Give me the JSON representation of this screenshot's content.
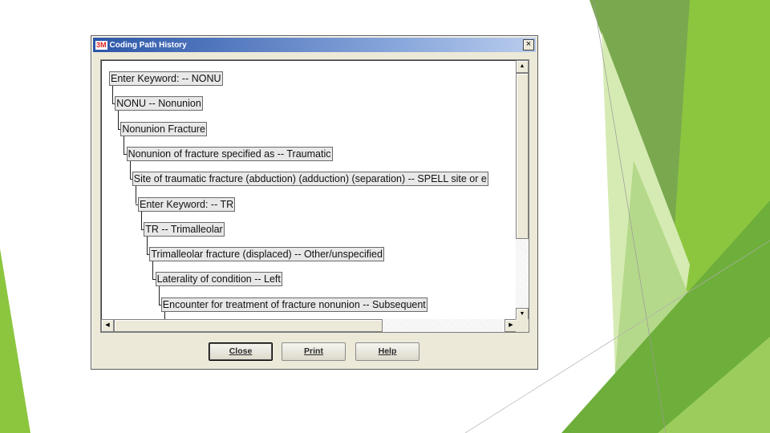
{
  "colors": {
    "green_dark": "#5e9e32",
    "green_mid": "#8cc63f",
    "green_light": "#c5e09a",
    "title_blue": "#2c56a8"
  },
  "window": {
    "logo": "3M",
    "title": "Coding Path History",
    "close_glyph": "×"
  },
  "tree": {
    "nodes": [
      "Enter Keyword:  -- NONU",
      "NONU --  Nonunion",
      "Nonunion     Fracture",
      "Nonunion of fracture specified as -- Traumatic",
      "Site of traumatic fracture (abduction) (adduction) (separation) --  SPELL site or e",
      "Enter Keyword: -- TR",
      "TR --  Trimalleolar",
      "Trimalleolar fracture (displaced) -- Other/unspecified",
      "Laterality of condition --  Left",
      "Encounter for treatment of fracture nonunion --  Subsequent"
    ]
  },
  "scrollbars": {
    "up": "▲",
    "down": "▼",
    "left": "◀",
    "right": "▶"
  },
  "buttons": {
    "close_label": "Close",
    "print_label": "Print",
    "help_label": "Help"
  }
}
